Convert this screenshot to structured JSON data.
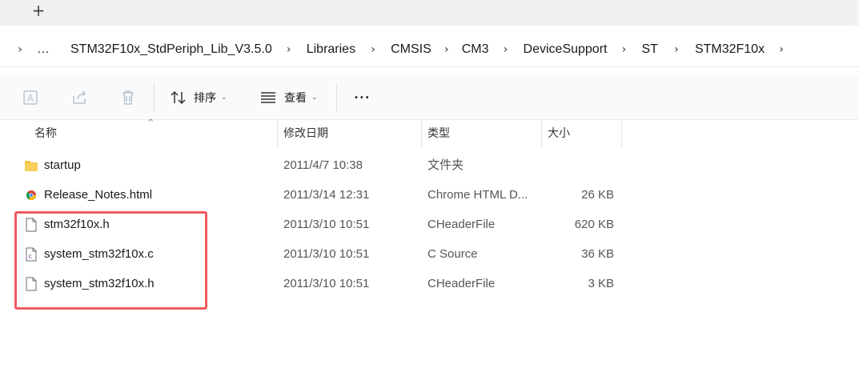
{
  "tabstrip": {
    "new_tab_icon": "plus-icon"
  },
  "address": {
    "crumbs": [
      "…",
      "STM32F10x_StdPeriph_Lib_V3.5.0",
      "Libraries",
      "CMSIS",
      "CM3",
      "DeviceSupport",
      "ST",
      "STM32F10x"
    ]
  },
  "toolbar": {
    "sort_label": "排序",
    "view_label": "查看",
    "more_label": "•••"
  },
  "columns": {
    "name": "名称",
    "modified": "修改日期",
    "type": "类型",
    "size": "大小"
  },
  "files": [
    {
      "name": "startup",
      "modified": "2011/4/7 10:38",
      "type": "文件夹",
      "size": "",
      "icon": "folder-icon"
    },
    {
      "name": "Release_Notes.html",
      "modified": "2011/3/14 12:31",
      "type": "Chrome HTML D...",
      "size": "26 KB",
      "icon": "chrome-html-icon"
    },
    {
      "name": "stm32f10x.h",
      "modified": "2011/3/10 10:51",
      "type": "CHeaderFile",
      "size": "620 KB",
      "icon": "header-file-icon"
    },
    {
      "name": "system_stm32f10x.c",
      "modified": "2011/3/10 10:51",
      "type": "C Source",
      "size": "36 KB",
      "icon": "c-source-file-icon"
    },
    {
      "name": "system_stm32f10x.h",
      "modified": "2011/3/10 10:51",
      "type": "CHeaderFile",
      "size": "3 KB",
      "icon": "header-file-icon"
    }
  ],
  "colors": {
    "highlight": "#ee5a5e",
    "folder": "#f4c245"
  }
}
